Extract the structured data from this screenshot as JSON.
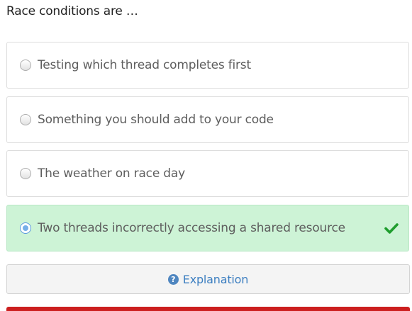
{
  "question": {
    "text": "Race conditions are …"
  },
  "options": [
    {
      "label": "Testing which thread completes first",
      "selected": false,
      "correct": false
    },
    {
      "label": "Something you should add to your code",
      "selected": false,
      "correct": false
    },
    {
      "label": "The weather on race day",
      "selected": false,
      "correct": false
    },
    {
      "label": "Two threads incorrectly accessing a shared resource",
      "selected": true,
      "correct": true
    }
  ],
  "explanation": {
    "label": "Explanation",
    "icon": "question-circle-icon"
  },
  "colors": {
    "correct_bg": "#cdf3d6",
    "check_green": "#1f9d2e",
    "link_blue": "#3d7fc1",
    "alert_red": "#cc1f1f"
  }
}
